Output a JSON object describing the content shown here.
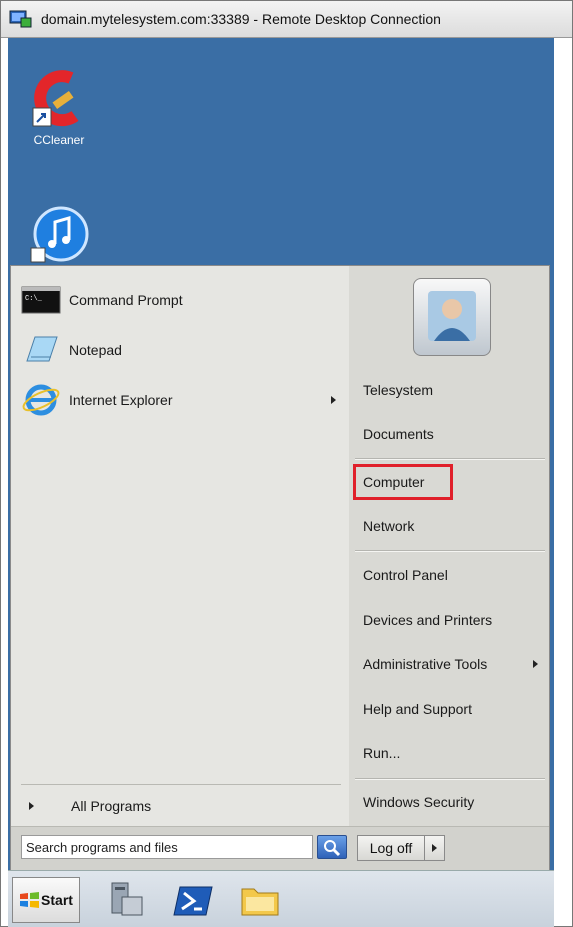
{
  "window": {
    "title": "domain.mytelesystem.com:33389 - Remote Desktop Connection"
  },
  "desktop": {
    "icons": [
      {
        "label": "CCleaner",
        "icon": "ccleaner-icon"
      },
      {
        "label": "",
        "icon": "itunes-icon"
      }
    ]
  },
  "start_menu": {
    "programs": [
      {
        "label": "Command Prompt",
        "icon": "command-prompt-icon"
      },
      {
        "label": "Notepad",
        "icon": "notepad-icon"
      },
      {
        "label": "Internet Explorer",
        "icon": "internet-explorer-icon"
      }
    ],
    "all_programs": "All Programs",
    "right_items": {
      "telesystem": "Telesystem",
      "documents": "Documents",
      "computer": "Computer",
      "network": "Network",
      "control_panel": "Control Panel",
      "devices_printers": "Devices and Printers",
      "admin_tools": "Administrative Tools",
      "help_support": "Help and Support",
      "run": "Run...",
      "windows_security": "Windows Security"
    },
    "search": {
      "placeholder": "Search programs and files"
    },
    "logoff": "Log off"
  },
  "taskbar": {
    "start_label": "Start",
    "icons": [
      "server-manager-icon",
      "powershell-icon",
      "explorer-folder-icon"
    ]
  },
  "colors": {
    "desktop": "#3a6ea5",
    "highlight": "#e0202a"
  }
}
